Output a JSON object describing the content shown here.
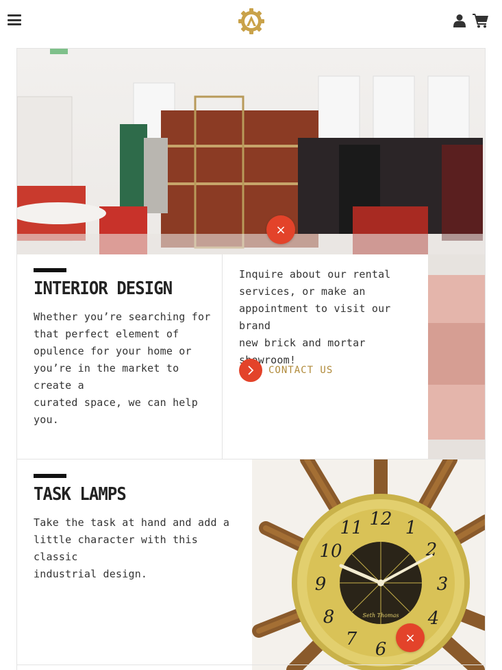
{
  "header": {
    "menu_icon": "hamburger-icon",
    "logo_icon": "gear-logo-icon",
    "account_icon": "user-icon",
    "cart_icon": "shopping-cart-icon"
  },
  "interior": {
    "title": "INTERIOR DESIGN",
    "description_lines": [
      "Whether you’re searching for",
      "that perfect element of",
      "opulence for your home or",
      "you’re in the market to create a",
      "curated space, we can help",
      "you."
    ],
    "cta_lines": [
      "Inquire about our rental",
      "services, or make an",
      "appointment to visit our brand",
      "new brick and mortar",
      "showroom!"
    ],
    "contact_label": "CONTACT US",
    "close_label": "×"
  },
  "lamps": {
    "title": "TASK LAMPS",
    "description_lines": [
      "Take the task at hand and add a",
      "little character with this classic",
      "industrial design."
    ],
    "close_label": "×",
    "clock_brand": "Seth Thomas"
  },
  "colors": {
    "accent_red": "#e3432a",
    "gold": "#b08a3a",
    "heading": "#222222"
  }
}
